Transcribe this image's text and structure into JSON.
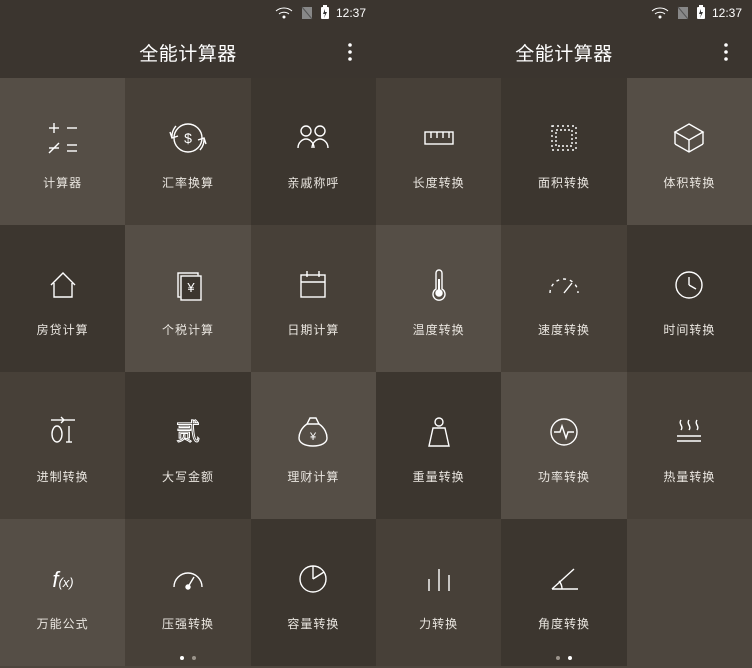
{
  "status": {
    "time": "12:37"
  },
  "screens": [
    {
      "title": "全能计算器",
      "page_indicator": {
        "count": 2,
        "active_index": 0
      },
      "tiles": [
        {
          "label": "计算器",
          "icon": "calc-ops",
          "shade": "a"
        },
        {
          "label": "汇率换算",
          "icon": "currency",
          "shade": "b"
        },
        {
          "label": "亲戚称呼",
          "icon": "relatives",
          "shade": "c"
        },
        {
          "label": "房贷计算",
          "icon": "house",
          "shade": "c"
        },
        {
          "label": "个税计算",
          "icon": "tax-doc",
          "shade": "a"
        },
        {
          "label": "日期计算",
          "icon": "calendar",
          "shade": "b"
        },
        {
          "label": "进制转换",
          "icon": "binary",
          "shade": "b"
        },
        {
          "label": "大写金额",
          "icon": "cn-numeral",
          "shade": "c"
        },
        {
          "label": "理财计算",
          "icon": "money-bag",
          "shade": "a"
        },
        {
          "label": "万能公式",
          "icon": "fx",
          "shade": "a"
        },
        {
          "label": "压强转换",
          "icon": "gauge",
          "shade": "b"
        },
        {
          "label": "容量转换",
          "icon": "pie",
          "shade": "c"
        }
      ]
    },
    {
      "title": "全能计算器",
      "page_indicator": {
        "count": 2,
        "active_index": 1
      },
      "tiles": [
        {
          "label": "长度转换",
          "icon": "ruler",
          "shade": "b"
        },
        {
          "label": "面积转换",
          "icon": "area",
          "shade": "c"
        },
        {
          "label": "体积转换",
          "icon": "cube",
          "shade": "a"
        },
        {
          "label": "温度转换",
          "icon": "thermo",
          "shade": "a"
        },
        {
          "label": "速度转换",
          "icon": "speed",
          "shade": "b"
        },
        {
          "label": "时间转换",
          "icon": "clock",
          "shade": "c"
        },
        {
          "label": "重量转换",
          "icon": "weight",
          "shade": "c"
        },
        {
          "label": "功率转换",
          "icon": "pulse",
          "shade": "a"
        },
        {
          "label": "热量转换",
          "icon": "heat",
          "shade": "b"
        },
        {
          "label": "力转换",
          "icon": "bars",
          "shade": "b"
        },
        {
          "label": "角度转换",
          "icon": "angle",
          "shade": "c"
        }
      ]
    }
  ]
}
